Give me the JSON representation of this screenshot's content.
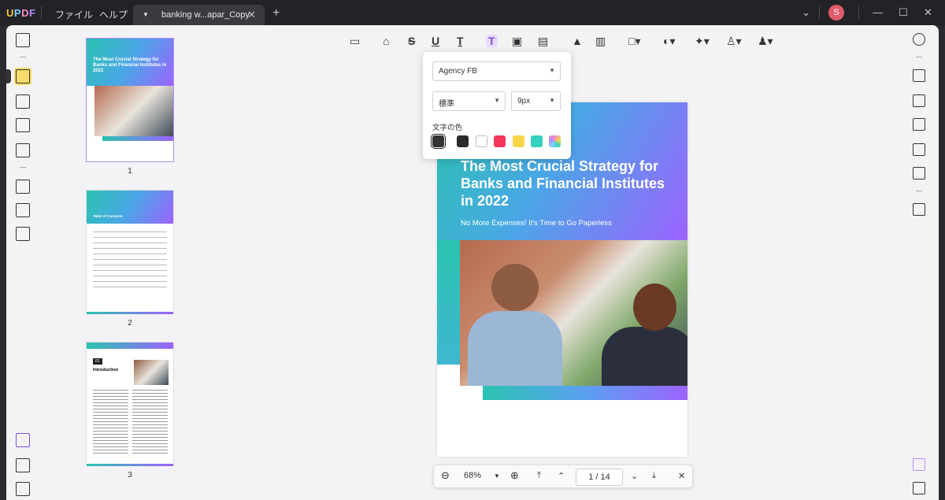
{
  "app": {
    "logo": "UPDF",
    "menu": [
      "ファイル",
      "ヘルプ"
    ],
    "tab_title": "banking w...apar_Copy",
    "avatar_initial": "S"
  },
  "popover": {
    "font_name": "Agency FB",
    "style_value": "標準",
    "size_value": "9px",
    "color_label": "文字の色",
    "colors": [
      "#333333",
      "#2a2a2a",
      "#ffffff",
      "#f4375b",
      "#f7d64a",
      "#34d1be",
      "#f58cc8"
    ]
  },
  "page": {
    "title": "The Most Crucial Strategy for Banks and Financial Institutes in 2022",
    "subtitle": "No More Expenses! It's Time to Go Paperless"
  },
  "thumbs": [
    {
      "num": "1",
      "title": "The Most Crucial Strategy for Banks and Financial Institutes in 2022"
    },
    {
      "num": "2",
      "title": "Table of Contents"
    },
    {
      "num": "3",
      "title": "Introduction",
      "badge": "01"
    }
  ],
  "nav": {
    "zoom": "68%",
    "current_page": "1",
    "separator": "/",
    "total_pages": "14"
  },
  "colors": {
    "accent": "#9d63ff",
    "teal": "#2ac3b0"
  }
}
